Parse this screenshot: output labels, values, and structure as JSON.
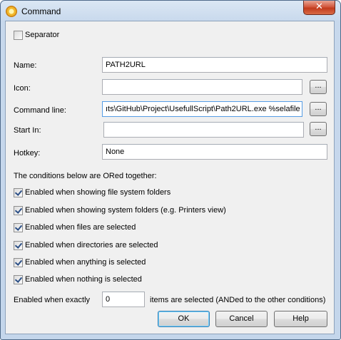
{
  "window": {
    "title": "Command",
    "close_glyph": "✕"
  },
  "separator": {
    "label": "Separator",
    "checked": false
  },
  "fields": {
    "name": {
      "label": "Name:",
      "value": "PATH2URL"
    },
    "icon": {
      "label": "Icon:",
      "value": "",
      "browse": "..."
    },
    "command_line": {
      "label": "Command line:",
      "value": "ıts\\GitHub\\Project\\UsefullScript\\Path2URL.exe %selafile",
      "browse": "..."
    },
    "start_in": {
      "label": "Start In:",
      "value": "",
      "browse": "..."
    },
    "hotkey": {
      "label": "Hotkey:",
      "value": "None"
    }
  },
  "conditions": {
    "heading": "The conditions below are ORed together:",
    "items": [
      {
        "label": "Enabled when showing file system folders",
        "checked": true
      },
      {
        "label": "Enabled when showing system folders (e.g. Printers view)",
        "checked": true
      },
      {
        "label": "Enabled when files are selected",
        "checked": true
      },
      {
        "label": "Enabled when directories are selected",
        "checked": true
      },
      {
        "label": "Enabled when anything is selected",
        "checked": true
      },
      {
        "label": "Enabled when nothing is selected",
        "checked": true
      }
    ]
  },
  "exactly": {
    "prefix": "Enabled when exactly",
    "value": "0",
    "suffix": "items are selected (ANDed to the other conditions)"
  },
  "buttons": {
    "ok": "OK",
    "cancel": "Cancel",
    "help": "Help"
  },
  "icons": {
    "app": "gear-icon",
    "close": "close-icon",
    "check": "check-icon"
  }
}
